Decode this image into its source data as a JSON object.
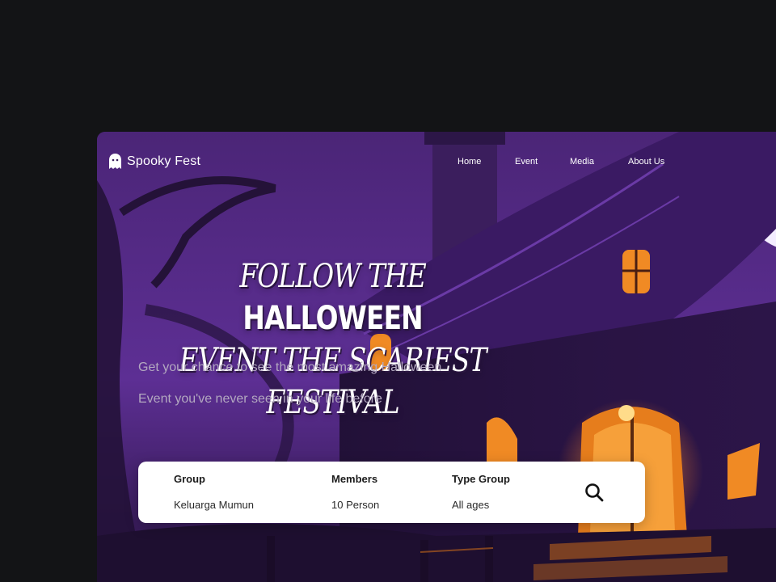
{
  "brand": {
    "name": "Spooky Fest"
  },
  "nav": {
    "items": [
      "Home",
      "Event",
      "Media",
      "About Us"
    ]
  },
  "hero": {
    "headline_line1_prefix": "FOLLOW THE ",
    "headline_line1_highlight": "HALLOWEEN",
    "headline_line2": "EVENT THE SCARIEST FESTIVAL",
    "subtitle_line1": "Get your chance to see the most amazing Halloween",
    "subtitle_line2": "Event you've never seen in your life before"
  },
  "search": {
    "fields": [
      {
        "label": "Group",
        "value": "Keluarga Mumun"
      },
      {
        "label": "Members",
        "value": "10 Person"
      },
      {
        "label": "Type Group",
        "value": "All ages"
      }
    ],
    "icon": "search-icon"
  },
  "colors": {
    "page_bg": "#131416",
    "hero_purple": "#5a2d8a",
    "window_glow": "#f08a24",
    "card_bg": "#ffffff"
  }
}
